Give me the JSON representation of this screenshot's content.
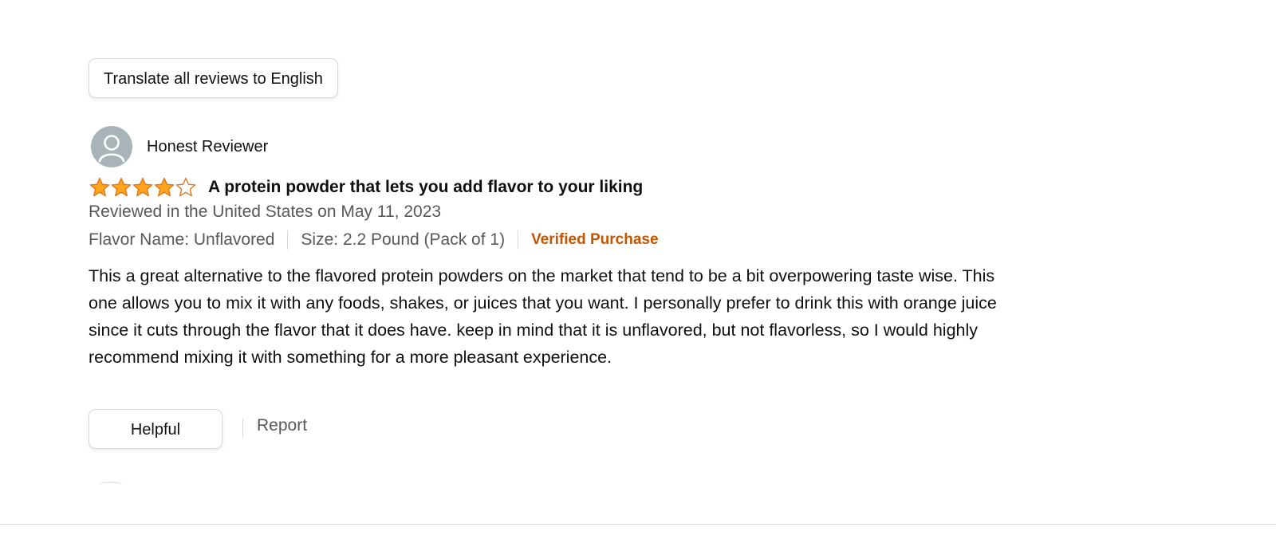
{
  "translate_button": {
    "label": "Translate all reviews to English"
  },
  "review": {
    "reviewer_name": "Honest Reviewer",
    "rating": 4,
    "rating_max": 5,
    "title": "A protein powder that lets you add flavor to your liking",
    "date_line": "Reviewed in the United States on May 11, 2023",
    "flavor": "Flavor Name: Unflavored",
    "size": "Size: 2.2 Pound (Pack of 1)",
    "verified": "Verified Purchase",
    "body": "This a great alternative to the flavored protein powders on the market that tend to be a bit overpowering taste wise. This one allows you to mix it with any foods, shakes, or juices that you want. I personally prefer to drink this with orange juice since it cuts through the flavor that it does have. keep in mind that it is unflavored, but not flavorless, so I would highly recommend mixing it with something for a more pleasant experience."
  },
  "actions": {
    "helpful_label": "Helpful",
    "report_label": "Report"
  },
  "colors": {
    "star_fill": "#ffa41c",
    "star_outline": "#de7921",
    "verified": "#c45500",
    "secondary_text": "#565959"
  },
  "icons": {
    "avatar": "user-avatar-icon",
    "star": "star-icon"
  }
}
